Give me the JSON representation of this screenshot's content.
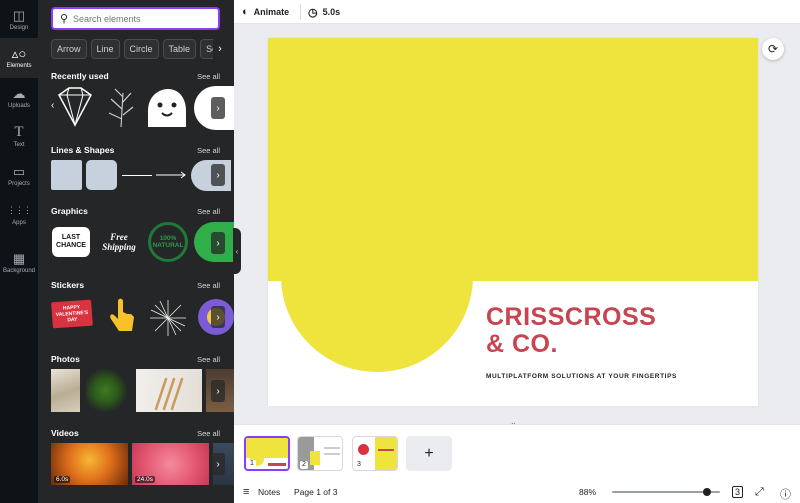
{
  "rail": [
    {
      "label": "Design",
      "icon": "layout-icon"
    },
    {
      "label": "Elements",
      "icon": "shapes-icon",
      "active": true
    },
    {
      "label": "Uploads",
      "icon": "cloud-upload-icon"
    },
    {
      "label": "Text",
      "icon": "text-icon"
    },
    {
      "label": "Projects",
      "icon": "folder-icon"
    },
    {
      "label": "Apps",
      "icon": "grid-icon"
    },
    {
      "label": "Background",
      "icon": "background-pattern-icon"
    }
  ],
  "search": {
    "placeholder": "Search elements"
  },
  "chips": [
    "Arrow",
    "Line",
    "Circle",
    "Table",
    "Square"
  ],
  "sections": {
    "recently_used": {
      "title": "Recently used",
      "see_all": "See all"
    },
    "lines_shapes": {
      "title": "Lines & Shapes",
      "see_all": "See all"
    },
    "graphics": {
      "title": "Graphics",
      "see_all": "See all"
    },
    "stickers": {
      "title": "Stickers",
      "see_all": "See all"
    },
    "photos": {
      "title": "Photos",
      "see_all": "See all"
    },
    "videos": {
      "title": "Videos",
      "see_all": "See all"
    }
  },
  "graphics_items": {
    "last_chance": "LAST CHANCE",
    "free_shipping": "Free Shipping",
    "natural": "100% NATURAL"
  },
  "sticker_items": {
    "valentines": "HAPPY VALENTINE'S DAY"
  },
  "videos": [
    {
      "duration": "6.0s"
    },
    {
      "duration": "24.0s"
    }
  ],
  "topbar": {
    "animate": "Animate",
    "duration": "5.0s"
  },
  "slide": {
    "title_line1": "CRISSCROSS",
    "title_line2": "& CO.",
    "subtitle": "MULTIPLATFORM SOLUTIONS AT YOUR FINGERTIPS",
    "colors": {
      "yellow": "#efe33e",
      "title_red": "#c64551"
    }
  },
  "pages": [
    {
      "number": "1",
      "active": true
    },
    {
      "number": "2"
    },
    {
      "number": "3"
    }
  ],
  "bottombar": {
    "notes": "Notes",
    "page_info": "Page 1 of 3",
    "zoom": "88%",
    "page_count_badge": "3"
  },
  "zoom_level": 0.88,
  "colors": {
    "accent": "#8b3dff",
    "panel_bg": "#252627",
    "rail_bg": "#0e1318"
  }
}
